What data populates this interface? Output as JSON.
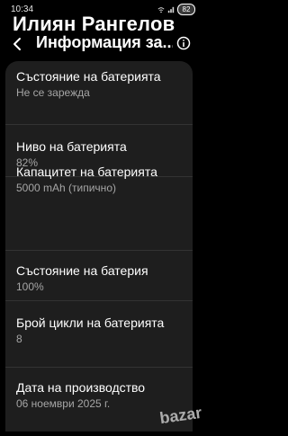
{
  "status_bar": {
    "time": "10:34",
    "battery_level": "82"
  },
  "watermark": "Илиян Рангелов",
  "header": {
    "title": "Информация за..."
  },
  "items": [
    {
      "title": "Състояние на батерията",
      "value": "Не се зарежда"
    },
    {
      "title": "Ниво на батерията",
      "value": "82%"
    },
    {
      "title": "Капацитет на батерията",
      "value": "5000 mAh (типично)"
    },
    {
      "title": "Състояние на батерия",
      "value": "100%"
    },
    {
      "title": "Брой цикли на батерията",
      "value": "8"
    },
    {
      "title": "Дата на производство",
      "value": "06 ноември 2025 г."
    }
  ],
  "corner_logo": "bazar"
}
